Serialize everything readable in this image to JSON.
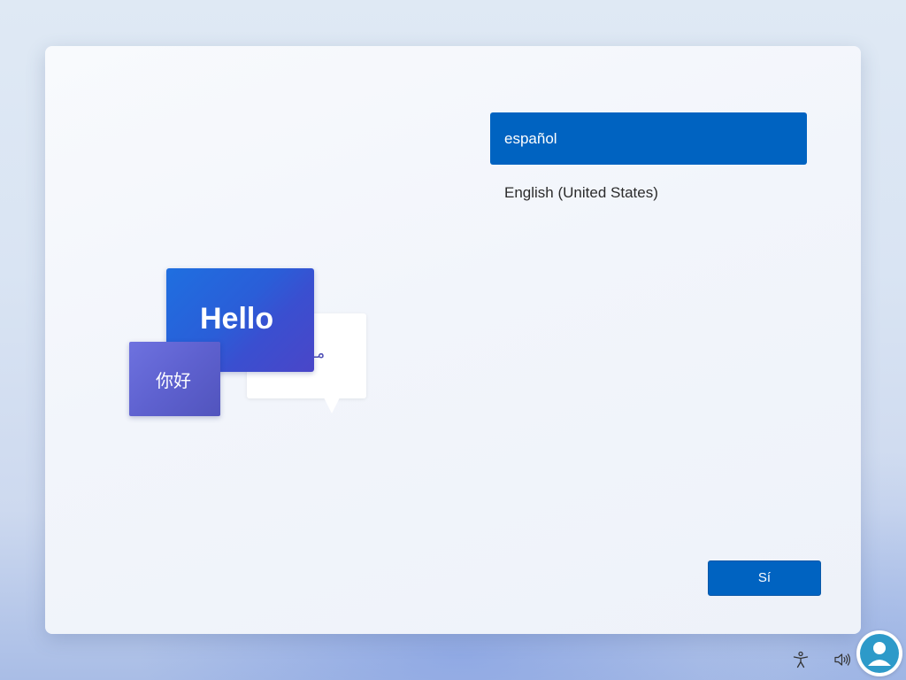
{
  "illustration": {
    "hello_text": "Hello",
    "chinese_text": "你好",
    "arabic_text": "مـ"
  },
  "language_list": {
    "items": [
      {
        "label": "español",
        "selected": true
      },
      {
        "label": "English (United States)",
        "selected": false
      }
    ]
  },
  "footer": {
    "yes_label": "Sí"
  },
  "tray": {
    "accessibility_icon": "accessibility-icon",
    "volume_icon": "volume-icon"
  },
  "colors": {
    "accent": "#0063c1",
    "hello_card": "#2a5ed8",
    "chinese_card": "#5e61cf",
    "watermark_logo": "#2d9ac9"
  }
}
